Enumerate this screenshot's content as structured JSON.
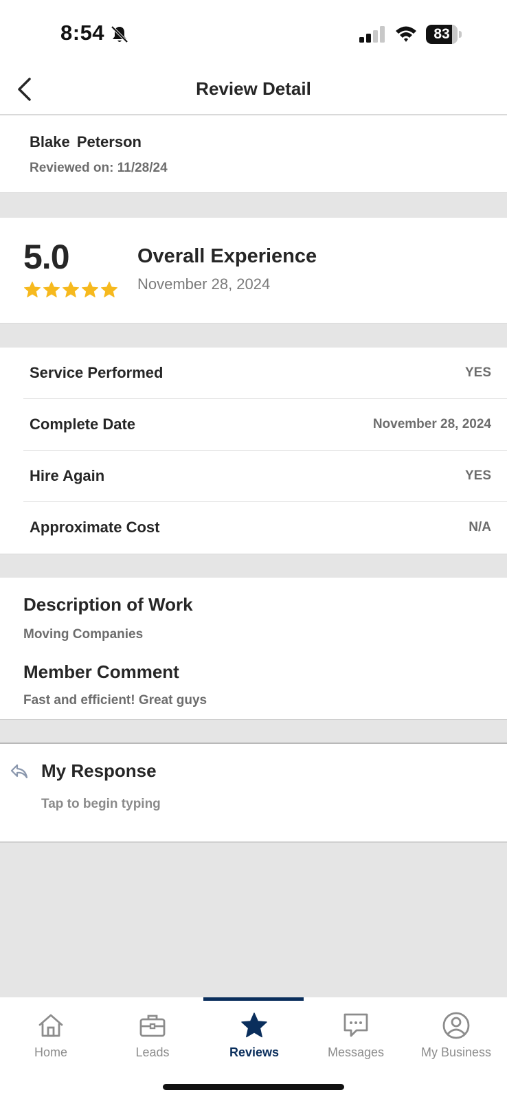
{
  "status_bar": {
    "time": "8:54",
    "battery_level": "83"
  },
  "nav": {
    "title": "Review Detail",
    "back_icon": "chevron-left-icon"
  },
  "reviewer": {
    "name": "Blake  Peterson",
    "reviewed_on": "Reviewed on: 11/28/24"
  },
  "rating": {
    "score": "5.0",
    "stars": 5,
    "star_color": "#f6b91e",
    "title": "Overall Experience",
    "date": "November 28, 2024"
  },
  "details": [
    {
      "label": "Service Performed",
      "value": "YES"
    },
    {
      "label": "Complete Date",
      "value": "November 28, 2024"
    },
    {
      "label": "Hire Again",
      "value": "YES"
    },
    {
      "label": "Approximate Cost",
      "value": "N/A"
    }
  ],
  "description": {
    "title": "Description of Work",
    "text": "Moving Companies"
  },
  "comment": {
    "title": "Member Comment",
    "text": "Fast and efficient! Great guys"
  },
  "response": {
    "title": "My Response",
    "placeholder": "Tap to begin typing",
    "icon": "reply-icon"
  },
  "tabs": [
    {
      "label": "Home",
      "icon": "home-icon",
      "active": false
    },
    {
      "label": "Leads",
      "icon": "briefcase-icon",
      "active": false
    },
    {
      "label": "Reviews",
      "icon": "star-icon",
      "active": true
    },
    {
      "label": "Messages",
      "icon": "message-icon",
      "active": false
    },
    {
      "label": "My Business",
      "icon": "user-circle-icon",
      "active": false
    }
  ],
  "colors": {
    "accent": "#0a2e5c",
    "divider_gray": "#e5e5e5"
  }
}
